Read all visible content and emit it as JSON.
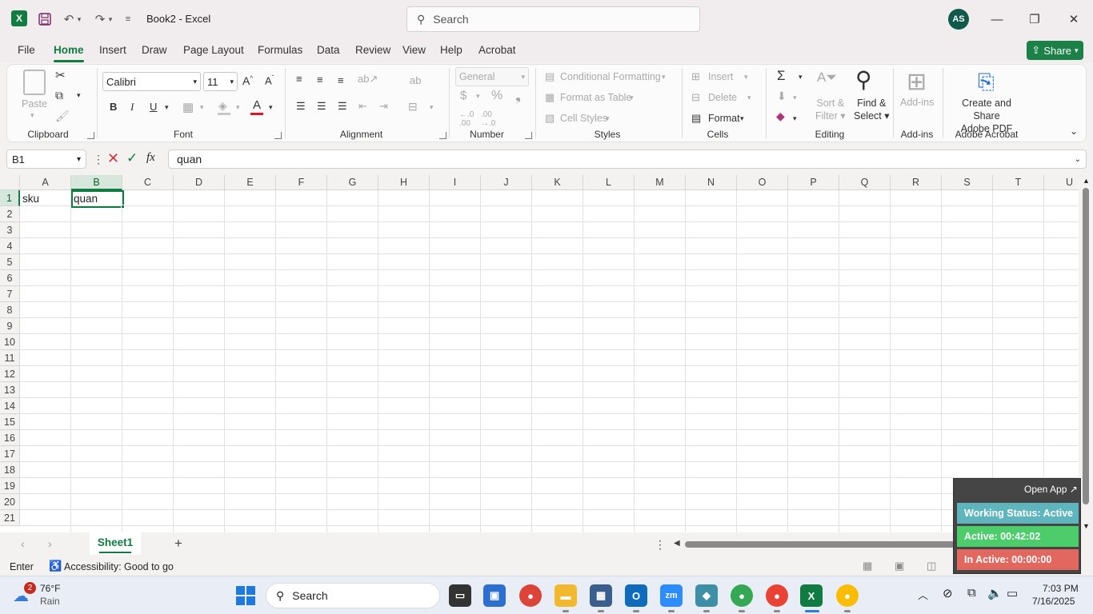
{
  "titlebar": {
    "doc_title": "Book2  -  Excel",
    "search_placeholder": "Search",
    "user_initials": "AS"
  },
  "tabs": [
    {
      "label": "File"
    },
    {
      "label": "Home"
    },
    {
      "label": "Insert"
    },
    {
      "label": "Draw"
    },
    {
      "label": "Page Layout"
    },
    {
      "label": "Formulas"
    },
    {
      "label": "Data"
    },
    {
      "label": "Review"
    },
    {
      "label": "View"
    },
    {
      "label": "Help"
    },
    {
      "label": "Acrobat"
    }
  ],
  "share_label": "Share",
  "ribbon": {
    "clipboard": {
      "group": "Clipboard",
      "paste": "Paste"
    },
    "font": {
      "group": "Font",
      "font_name": "Calibri",
      "font_size": "11",
      "bold": "B",
      "italic": "I",
      "underline": "U"
    },
    "alignment": {
      "group": "Alignment"
    },
    "number": {
      "group": "Number",
      "format": "General"
    },
    "styles": {
      "group": "Styles",
      "conditional": "Conditional Formatting",
      "format_table": "Format as Table",
      "cell_styles": "Cell Styles"
    },
    "cells": {
      "group": "Cells",
      "insert": "Insert",
      "delete": "Delete",
      "format": "Format"
    },
    "editing": {
      "group": "Editing",
      "sort_filter_1": "Sort &",
      "sort_filter_2": "Filter",
      "find_select_1": "Find &",
      "find_select_2": "Select"
    },
    "addins": {
      "group": "Add-ins",
      "label": "Add-ins"
    },
    "acrobat": {
      "group": "Adobe Acrobat",
      "create_1": "Create and Share",
      "create_2": "Adobe PDF"
    }
  },
  "formula_bar": {
    "name_box": "B1",
    "formula": "quan"
  },
  "grid": {
    "columns": [
      "A",
      "B",
      "C",
      "D",
      "E",
      "F",
      "G",
      "H",
      "I",
      "J",
      "K",
      "L",
      "M",
      "N",
      "O",
      "P",
      "Q",
      "R",
      "S",
      "T",
      "U"
    ],
    "rows": [
      "1",
      "2",
      "3",
      "4",
      "5",
      "6",
      "7",
      "8",
      "9",
      "10",
      "11",
      "12",
      "13",
      "14",
      "15",
      "16",
      "17",
      "18",
      "19",
      "20",
      "21"
    ],
    "cells": {
      "A1": "sku",
      "B1": "quan"
    }
  },
  "sheets": {
    "active": "Sheet1"
  },
  "status": {
    "mode": "Enter",
    "accessibility": "Accessibility: Good to go"
  },
  "widget": {
    "open_app": "Open App ↗",
    "working": "Working Status: Active",
    "active": "Active: 00:42:02",
    "inactive": "In Active: 00:00:00"
  },
  "taskbar": {
    "weather_badge": "2",
    "temp": "76°F",
    "condition": "Rain",
    "search": "Search",
    "time": "7:03 PM",
    "date": "7/16/2025"
  },
  "colors": {
    "excel_green": "#107c41",
    "share_green": "#1b8146",
    "selection": "#107c41",
    "working": "#5fb5bd",
    "active": "#4ccc6b",
    "inactive": "#e2675f"
  }
}
